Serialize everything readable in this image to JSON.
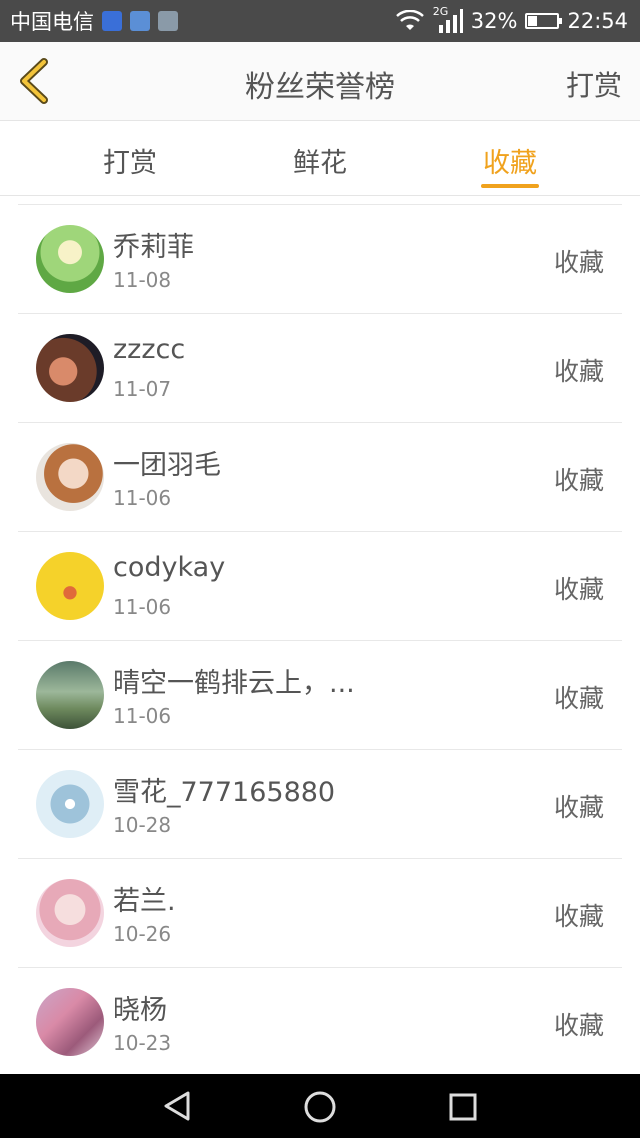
{
  "status_bar": {
    "carrier": "中国电信",
    "network": "2G",
    "battery_percent": "32%",
    "time": "22:54"
  },
  "header": {
    "title": "粉丝荣誉榜",
    "action_label": "打赏"
  },
  "tabs": [
    {
      "label": "打赏",
      "active": false
    },
    {
      "label": "鲜花",
      "active": false
    },
    {
      "label": "收藏",
      "active": true
    }
  ],
  "accent_color": "#f0a21d",
  "list": [
    {
      "name": "乔莉菲",
      "date": "11-08",
      "action": "收藏"
    },
    {
      "name": "zzzcc",
      "date": "11-07",
      "action": "收藏"
    },
    {
      "name": "一团羽毛",
      "date": "11-06",
      "action": "收藏"
    },
    {
      "name": "codykay",
      "date": "11-06",
      "action": "收藏"
    },
    {
      "name": "晴空一鹤排云上，...",
      "date": "11-06",
      "action": "收藏"
    },
    {
      "name": "雪花_777165880",
      "date": "10-28",
      "action": "收藏"
    },
    {
      "name": "若兰.",
      "date": "10-26",
      "action": "收藏"
    },
    {
      "name": "晓杨",
      "date": "10-23",
      "action": "收藏"
    }
  ]
}
